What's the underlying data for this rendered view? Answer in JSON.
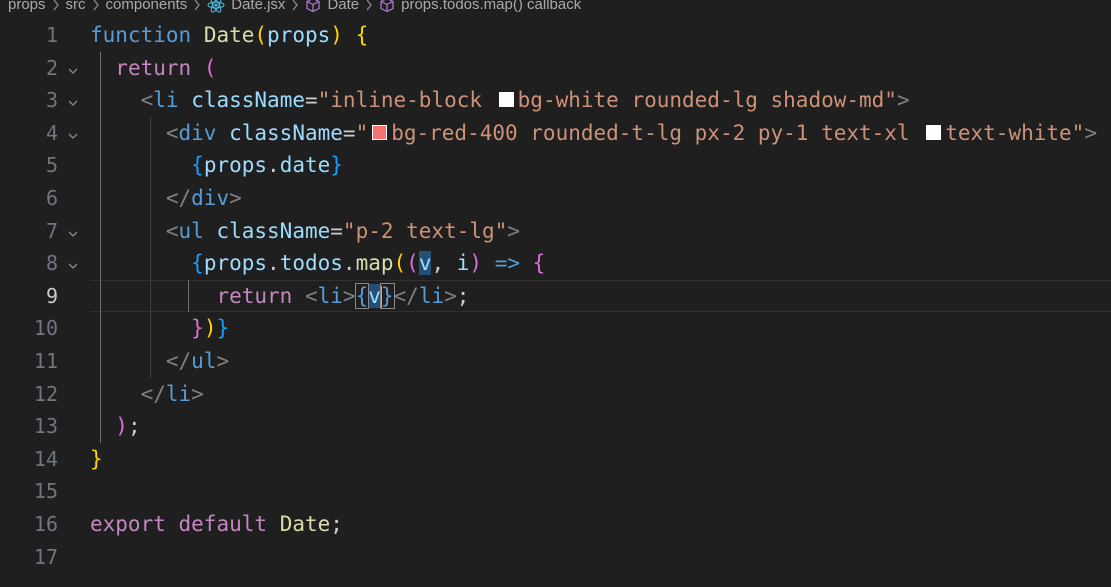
{
  "breadcrumb": {
    "items": [
      {
        "label": "props",
        "icon": null
      },
      {
        "label": "src",
        "icon": null
      },
      {
        "label": "components",
        "icon": null
      },
      {
        "label": "Date.jsx",
        "icon": "react-icon"
      },
      {
        "label": "Date",
        "icon": "cube-icon"
      },
      {
        "label": "props.todos.map() callback",
        "icon": "cube-icon"
      }
    ]
  },
  "editor": {
    "active_line": 9,
    "line_numbers": [
      "1",
      "2",
      "3",
      "4",
      "5",
      "6",
      "7",
      "8",
      "9",
      "10",
      "11",
      "12",
      "13",
      "14",
      "15",
      "16",
      "17"
    ],
    "swatch_colors": {
      "white": "#ffffff",
      "red-400": "#f87171"
    },
    "lines": {
      "l1": {
        "t1": "function",
        "t2": "Date",
        "t3": "(",
        "t4": "props",
        "t5": ")",
        "t6": "{"
      },
      "l2": {
        "t1": "return",
        "t2": "("
      },
      "l3": {
        "t1": "<",
        "t2": "li",
        "t3": "className",
        "t4": "=",
        "t5": "\"inline-block ",
        "t6": "bg-white rounded-lg shadow-md\"",
        "t7": ">"
      },
      "l4": {
        "t1": "<",
        "t2": "div",
        "t3": "className",
        "t4": "=",
        "t5": "\"",
        "t6": "bg-red-400 rounded-t-lg px-2 py-1 text-xl ",
        "t7": "text-white\"",
        "t8": ">"
      },
      "l5": {
        "t1": "{",
        "t2": "props",
        "t3": ".",
        "t4": "date",
        "t5": "}"
      },
      "l6": {
        "t1": "</",
        "t2": "div",
        "t3": ">"
      },
      "l7": {
        "t1": "<",
        "t2": "ul",
        "t3": "className",
        "t4": "=",
        "t5": "\"p-2 text-lg\"",
        "t6": ">"
      },
      "l8": {
        "t1": "{",
        "t2": "props",
        "t3": ".",
        "t4": "todos",
        "t5": ".",
        "t6": "map",
        "t7": "(",
        "t8": "(",
        "t9": "v",
        "t10": ", ",
        "t11": "i",
        "t12": ")",
        "t13": " => ",
        "t14": "{"
      },
      "l9": {
        "t1": "return",
        "t2": "<",
        "t3": "li",
        "t4": ">",
        "t5": "{",
        "t6": "v",
        "t7": "}",
        "t8": "</",
        "t9": "li",
        "t10": ">",
        "t11": ";"
      },
      "l10": {
        "t1": "}",
        "t2": ")",
        "t3": "}"
      },
      "l11": {
        "t1": "</",
        "t2": "ul",
        "t3": ">"
      },
      "l12": {
        "t1": "</",
        "t2": "li",
        "t3": ">"
      },
      "l13": {
        "t1": ")",
        "t2": ";"
      },
      "l14": {
        "t1": "}"
      },
      "l16": {
        "t1": "export",
        "t2": "default",
        "t3": "Date",
        "t4": ";"
      }
    }
  }
}
